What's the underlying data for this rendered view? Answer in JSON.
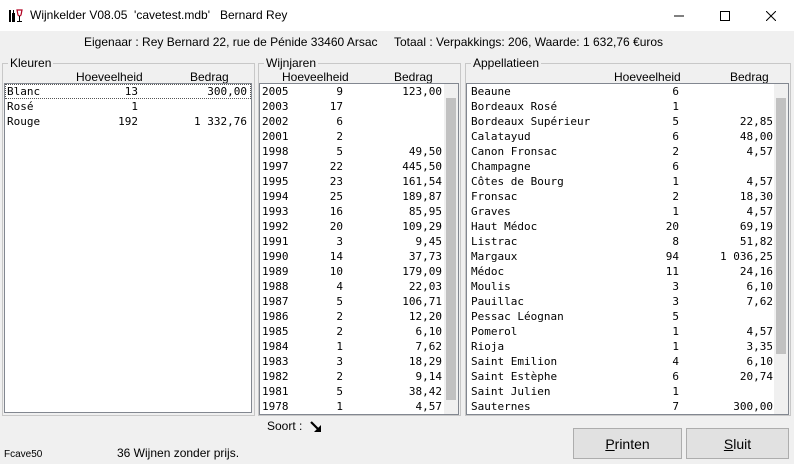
{
  "window": {
    "title": "Wijnkelder V08.05  'cavetest.mdb'   Bernard Rey",
    "minimize_label": "minimize",
    "maximize_label": "maximize",
    "close_label": "close"
  },
  "owner_line": "Eigenaar : Rey Bernard 22, rue de Pénide 33460 Arsac     Totaal : Verpakkings: 206, Waarde: 1 632,76 €uros",
  "kleuren": {
    "legend": "Kleuren",
    "col_qty": "Hoeveelheid",
    "col_amount": "Bedrag",
    "rows": [
      {
        "name": "Blanc",
        "qty": "13",
        "amount": "300,00",
        "selected": true
      },
      {
        "name": "Rosé",
        "qty": "1",
        "amount": ""
      },
      {
        "name": "Rouge",
        "qty": "192",
        "amount": "1 332,76"
      }
    ]
  },
  "wijnjaren": {
    "legend": "Wijnjaren",
    "col_qty": "Hoeveelheid",
    "col_amount": "Bedrag",
    "scroll_position": 0,
    "rows": [
      {
        "name": "2005",
        "qty": "9",
        "amount": "123,00"
      },
      {
        "name": "2003",
        "qty": "17",
        "amount": ""
      },
      {
        "name": "2002",
        "qty": "6",
        "amount": ""
      },
      {
        "name": "2001",
        "qty": "2",
        "amount": ""
      },
      {
        "name": "1998",
        "qty": "5",
        "amount": "49,50"
      },
      {
        "name": "1997",
        "qty": "22",
        "amount": "445,50"
      },
      {
        "name": "1995",
        "qty": "23",
        "amount": "161,54"
      },
      {
        "name": "1994",
        "qty": "25",
        "amount": "189,87"
      },
      {
        "name": "1993",
        "qty": "16",
        "amount": "85,95"
      },
      {
        "name": "1992",
        "qty": "20",
        "amount": "109,29"
      },
      {
        "name": "1991",
        "qty": "3",
        "amount": "9,45"
      },
      {
        "name": "1990",
        "qty": "14",
        "amount": "37,73"
      },
      {
        "name": "1989",
        "qty": "10",
        "amount": "179,09"
      },
      {
        "name": "1988",
        "qty": "4",
        "amount": "22,03"
      },
      {
        "name": "1987",
        "qty": "5",
        "amount": "106,71"
      },
      {
        "name": "1986",
        "qty": "2",
        "amount": "12,20"
      },
      {
        "name": "1985",
        "qty": "2",
        "amount": "6,10"
      },
      {
        "name": "1984",
        "qty": "1",
        "amount": "7,62"
      },
      {
        "name": "1983",
        "qty": "3",
        "amount": "18,29"
      },
      {
        "name": "1982",
        "qty": "2",
        "amount": "9,14"
      },
      {
        "name": "1981",
        "qty": "5",
        "amount": "38,42"
      },
      {
        "name": "1978",
        "qty": "1",
        "amount": "4,57"
      }
    ]
  },
  "appellaties": {
    "legend": "Appellatieen",
    "col_qty": "Hoeveelheid",
    "col_amount": "Bedrag",
    "scroll_position": 0,
    "rows": [
      {
        "name": "Beaune",
        "qty": "6",
        "amount": ""
      },
      {
        "name": "Bordeaux Rosé",
        "qty": "1",
        "amount": ""
      },
      {
        "name": "Bordeaux Supérieur",
        "qty": "5",
        "amount": "22,85"
      },
      {
        "name": "Calatayud",
        "qty": "6",
        "amount": "48,00"
      },
      {
        "name": "Canon Fronsac",
        "qty": "2",
        "amount": "4,57"
      },
      {
        "name": "Champagne",
        "qty": "6",
        "amount": ""
      },
      {
        "name": "Côtes de Bourg",
        "qty": "1",
        "amount": "4,57"
      },
      {
        "name": "Fronsac",
        "qty": "2",
        "amount": "18,30"
      },
      {
        "name": "Graves",
        "qty": "1",
        "amount": "4,57"
      },
      {
        "name": "Haut Médoc",
        "qty": "20",
        "amount": "69,19"
      },
      {
        "name": "Listrac",
        "qty": "8",
        "amount": "51,82"
      },
      {
        "name": "Margaux",
        "qty": "94",
        "amount": "1 036,25"
      },
      {
        "name": "Médoc",
        "qty": "11",
        "amount": "24,16"
      },
      {
        "name": "Moulis",
        "qty": "3",
        "amount": "6,10"
      },
      {
        "name": "Pauillac",
        "qty": "3",
        "amount": "7,62"
      },
      {
        "name": "Pessac Léognan",
        "qty": "5",
        "amount": ""
      },
      {
        "name": "Pomerol",
        "qty": "1",
        "amount": "4,57"
      },
      {
        "name": "Rioja",
        "qty": "1",
        "amount": "3,35"
      },
      {
        "name": "Saint Emilion",
        "qty": "4",
        "amount": "6,10"
      },
      {
        "name": "Saint Estèphe",
        "qty": "6",
        "amount": "20,74"
      },
      {
        "name": "Saint Julien",
        "qty": "1",
        "amount": ""
      },
      {
        "name": "Sauternes",
        "qty": "7",
        "amount": "300,00"
      }
    ]
  },
  "sort": {
    "label": "Soort :",
    "icon": "sort-descending-arrow-icon"
  },
  "status": {
    "left": "Fcave50",
    "message": "36 Wijnen zonder prijs."
  },
  "buttons": {
    "print": "Printen",
    "close": "Sluit"
  },
  "colors": {
    "list_bg": "#ffffff",
    "window_bg": "#f0f0f0",
    "scroll_thumb": "#c1c1c1"
  }
}
